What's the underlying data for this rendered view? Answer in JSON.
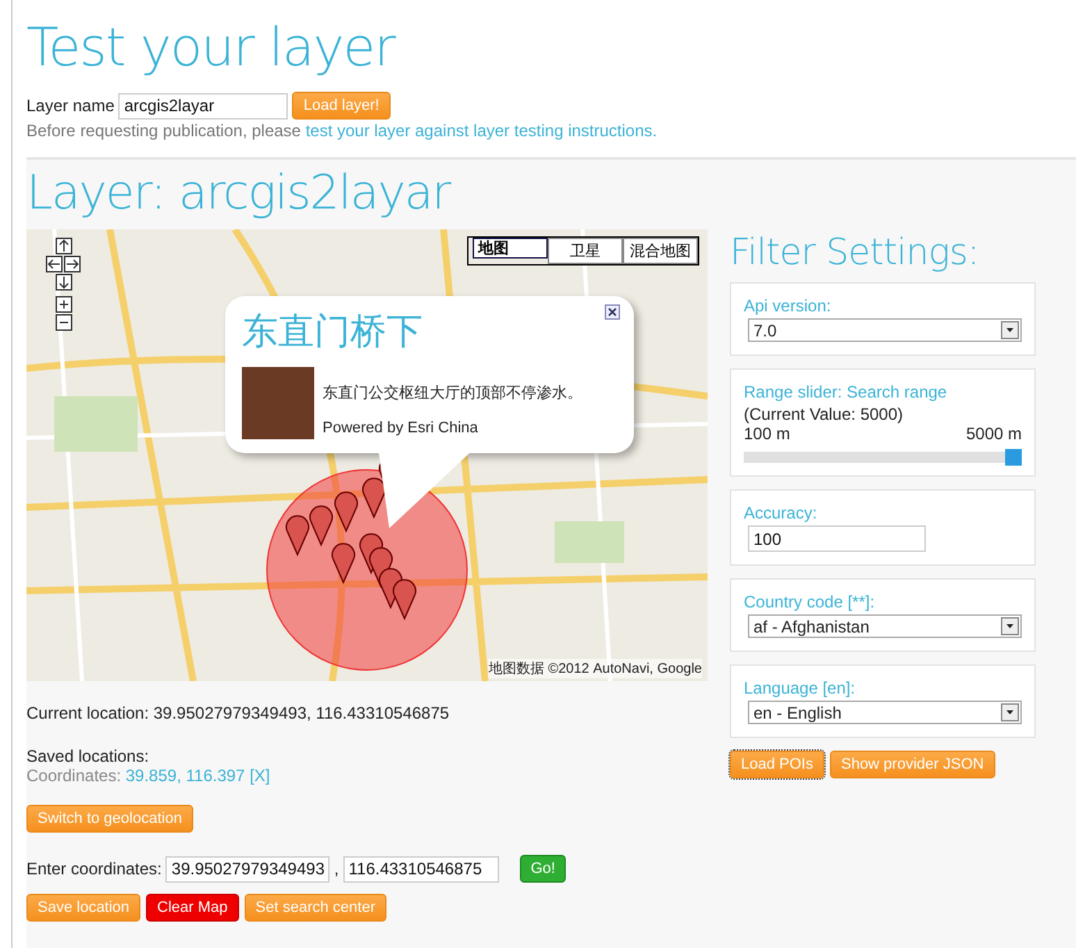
{
  "title": "Test your layer",
  "layer_form": {
    "label": "Layer name",
    "value": "arcgis2layar",
    "button": "Load layer!"
  },
  "notice": {
    "text": "Before requesting publication, please ",
    "link": "test your layer against layer testing instructions."
  },
  "layer_heading": "Layer: arcgis2layar",
  "map": {
    "map_types": [
      {
        "label": "地图",
        "selected": true
      },
      {
        "label": "卫星",
        "selected": false
      },
      {
        "label": "混合地图",
        "selected": false
      }
    ],
    "popup": {
      "title": "东直门桥下",
      "description": "东直门公交枢纽大厅的顶部不停渗水。",
      "credit": "Powered by Esri China"
    },
    "attribution": "地图数据 ©2012 AutoNavi, Google"
  },
  "current_location": "Current location: 39.95027979349493, 116.43310546875",
  "saved": {
    "heading": "Saved locations:",
    "label": "Coordinates: ",
    "link": "39.859, 116.397 [X]"
  },
  "geo_button": "Switch to geolocation",
  "coords": {
    "label": "Enter coordinates:",
    "lat": "39.95027979349493",
    "separator": ",",
    "lon": "116.43310546875",
    "button": "Go!"
  },
  "actions": [
    {
      "label": "Save location",
      "kind": "normal"
    },
    {
      "label": "Clear Map",
      "kind": "danger"
    },
    {
      "label": "Set search center",
      "kind": "normal"
    }
  ],
  "filter": {
    "heading": "Filter Settings:",
    "fields": [
      {
        "kind": "select",
        "label": "Api version:",
        "value": "7.0"
      },
      {
        "kind": "slider",
        "label": "Range slider: Search range",
        "note": "(Current Value: 5000)",
        "min": "100 m",
        "max": "5000 m",
        "level": 1.0
      },
      {
        "kind": "text",
        "label": "Accuracy:",
        "value": "100"
      },
      {
        "kind": "select",
        "label": "Country code [**]:",
        "value": "af - Afghanistan"
      },
      {
        "kind": "select",
        "label": "Language [en]:",
        "value": "en - English"
      }
    ],
    "buttons": [
      "Load POIs",
      "Show provider JSON"
    ]
  }
}
